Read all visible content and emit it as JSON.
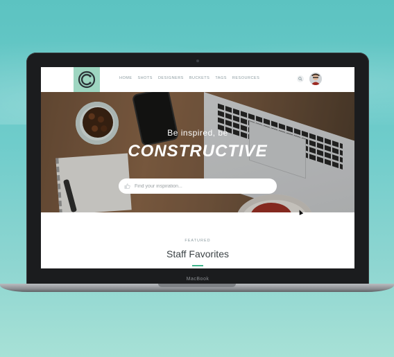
{
  "device": {
    "brand_label": "MacBook"
  },
  "site": {
    "logo_letter": "C",
    "nav": [
      {
        "label": "HOME"
      },
      {
        "label": "SHOTS"
      },
      {
        "label": "DESIGNERS"
      },
      {
        "label": "BUCKETS"
      },
      {
        "label": "TAGS"
      },
      {
        "label": "RESOURCES"
      }
    ],
    "icons": {
      "search": "search-icon",
      "avatar": "user-avatar",
      "hero_search": "thumbs-up-icon"
    },
    "colors": {
      "logo_bg": "#9ed6c1",
      "accent": "#3fb58c",
      "nav_text": "#8a9a9f"
    }
  },
  "hero": {
    "subtitle": "Be inspired, be",
    "title": "CONSTRUCTIVE",
    "search_placeholder": "Find your inspiration..."
  },
  "featured": {
    "label": "FEATURED",
    "title": "Staff Favorites"
  }
}
